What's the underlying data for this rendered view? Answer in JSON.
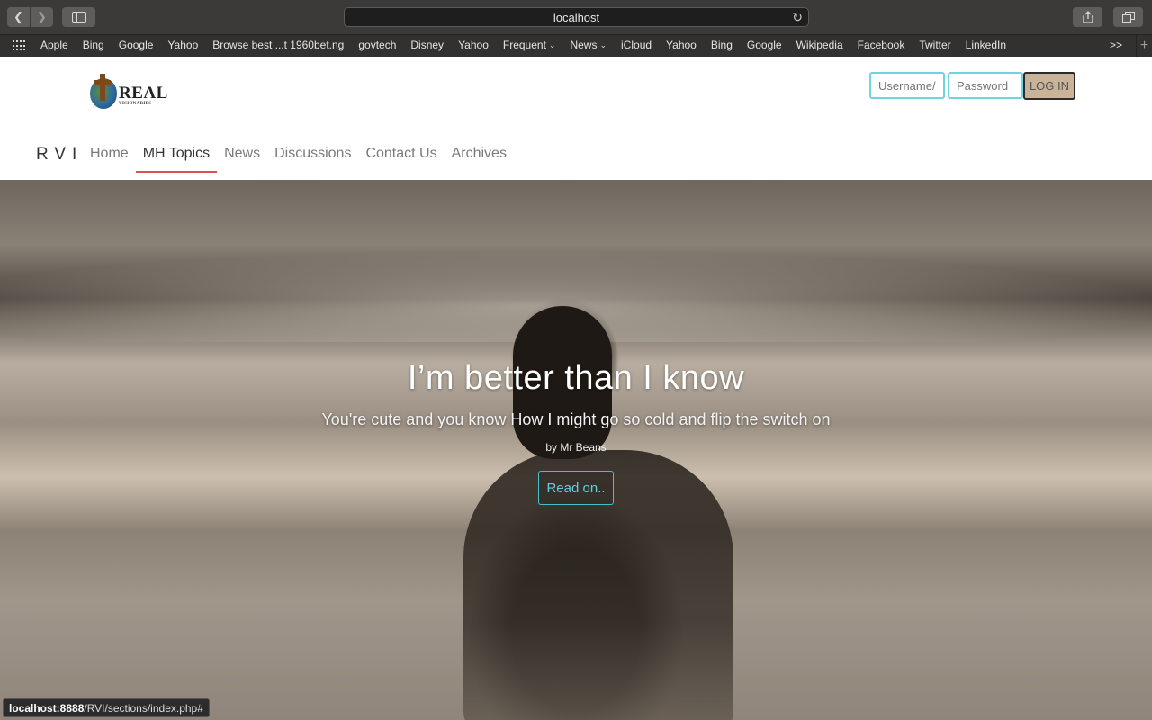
{
  "browser": {
    "url": "localhost",
    "icons": {
      "back": "chevron-left-icon",
      "forward": "chevron-right-icon",
      "sidebar": "sidebar-icon",
      "reload": "reload-icon",
      "share": "share-icon",
      "tabs": "tabs-icon"
    }
  },
  "bookmarks": {
    "items": [
      {
        "label": "Apple"
      },
      {
        "label": "Bing"
      },
      {
        "label": "Google"
      },
      {
        "label": "Yahoo"
      },
      {
        "label": "Browse best ...t 1960bet.ng"
      },
      {
        "label": "govtech"
      },
      {
        "label": "Disney"
      },
      {
        "label": "Yahoo"
      },
      {
        "label": "Frequent",
        "dropdown": true
      },
      {
        "label": "News",
        "dropdown": true
      },
      {
        "label": "iCloud"
      },
      {
        "label": "Yahoo"
      },
      {
        "label": "Bing"
      },
      {
        "label": "Google"
      },
      {
        "label": "Wikipedia"
      },
      {
        "label": "Facebook"
      },
      {
        "label": "Twitter"
      },
      {
        "label": "LinkedIn"
      }
    ],
    "more": ">>",
    "add": "+"
  },
  "site": {
    "logo": {
      "text": "REAL",
      "sub": "VISIONARIES"
    },
    "login": {
      "username_placeholder": "Username/email",
      "password_placeholder": "Password",
      "button": "LOG IN"
    },
    "brand": "RVI",
    "nav": [
      {
        "label": "Home"
      },
      {
        "label": "MH Topics",
        "active": true
      },
      {
        "label": "News"
      },
      {
        "label": "Discussions"
      },
      {
        "label": "Contact Us"
      },
      {
        "label": "Archives"
      }
    ]
  },
  "hero": {
    "title": "I’m better than I know",
    "subtitle": "You're cute and you know How I might go so cold and flip the switch on",
    "author": "by Mr Beans",
    "button": "Read on.."
  },
  "status": {
    "host": "localhost:8888",
    "path": "/RVI/sections/index.php#"
  },
  "colors": {
    "accent": "#d9534f",
    "input_border": "#6fd3e0",
    "read_button": "#48c0cc",
    "login_button": "#c9b49a"
  }
}
